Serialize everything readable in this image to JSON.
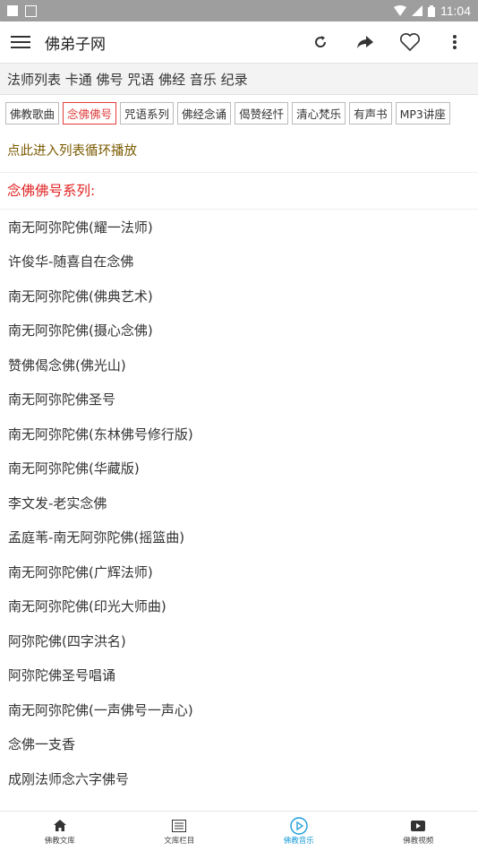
{
  "status": {
    "time": "11:04"
  },
  "toolbar": {
    "title": "佛弟子网"
  },
  "categories": "法师列表 卡通 佛号 咒语 佛经 音乐 纪录",
  "tags": [
    {
      "label": "佛教歌曲",
      "active": false
    },
    {
      "label": "念佛佛号",
      "active": true
    },
    {
      "label": "咒语系列",
      "active": false
    },
    {
      "label": "佛经念诵",
      "active": false
    },
    {
      "label": "偈赞经忏",
      "active": false
    },
    {
      "label": "清心梵乐",
      "active": false
    },
    {
      "label": "有声书",
      "active": false
    },
    {
      "label": "MP3讲座",
      "active": false
    }
  ],
  "play_all": "点此进入列表循环播放",
  "section_title": "念佛佛号系列:",
  "items": [
    "南无阿弥陀佛(耀一法师)",
    "许俊华-随喜自在念佛",
    "南无阿弥陀佛(佛典艺术)",
    "南无阿弥陀佛(摄心念佛)",
    "赞佛偈念佛(佛光山)",
    "南无阿弥陀佛圣号",
    "南无阿弥陀佛(东林佛号修行版)",
    "南无阿弥陀佛(华藏版)",
    "李文发-老实念佛",
    "孟庭苇-南无阿弥陀佛(摇篮曲)",
    "南无阿弥陀佛(广辉法师)",
    "南无阿弥陀佛(印光大师曲)",
    "阿弥陀佛(四字洪名)",
    "阿弥陀佛圣号唱诵",
    "南无阿弥陀佛(一声佛号一声心)",
    "念佛一支香",
    "成刚法师念六字佛号"
  ],
  "nav": [
    {
      "label": "佛教文库",
      "icon": "home-icon",
      "active": false
    },
    {
      "label": "文库栏目",
      "icon": "list-icon",
      "active": false
    },
    {
      "label": "佛教音乐",
      "icon": "play-circle-icon",
      "active": true
    },
    {
      "label": "佛教视频",
      "icon": "video-icon",
      "active": false
    }
  ],
  "colors": {
    "accent": "#1a9cd8",
    "section": "#e02020",
    "play_all": "#7a5a00"
  }
}
